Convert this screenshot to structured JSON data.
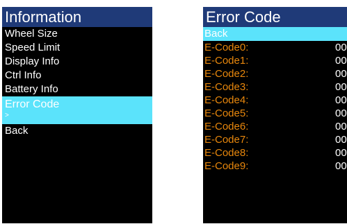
{
  "colors": {
    "title_bar": "#1f3a78",
    "highlight": "#5be3fb",
    "label_orange": "#e8870c",
    "background": "#000000",
    "text": "#ffffff"
  },
  "left_screen": {
    "title": "Information",
    "items": [
      {
        "label": "Wheel Size"
      },
      {
        "label": "Speed Limit"
      },
      {
        "label": "Display Info"
      },
      {
        "label": "Ctrl Info"
      },
      {
        "label": "Battery Info"
      },
      {
        "label": "Error Code",
        "sub": ">"
      },
      {
        "label": "Back"
      }
    ]
  },
  "right_screen": {
    "title": "Error Code",
    "back_label": "Back",
    "codes": [
      {
        "label": "E-Code0:",
        "value": "00"
      },
      {
        "label": "E-Code1:",
        "value": "00"
      },
      {
        "label": "E-Code2:",
        "value": "00"
      },
      {
        "label": "E-Code3:",
        "value": "00"
      },
      {
        "label": "E-Code4:",
        "value": "00"
      },
      {
        "label": "E-Code5:",
        "value": "00"
      },
      {
        "label": "E-Code6:",
        "value": "00"
      },
      {
        "label": "E-Code7:",
        "value": "00"
      },
      {
        "label": "E-Code8:",
        "value": "00"
      },
      {
        "label": "E-Code9:",
        "value": "00"
      }
    ]
  }
}
